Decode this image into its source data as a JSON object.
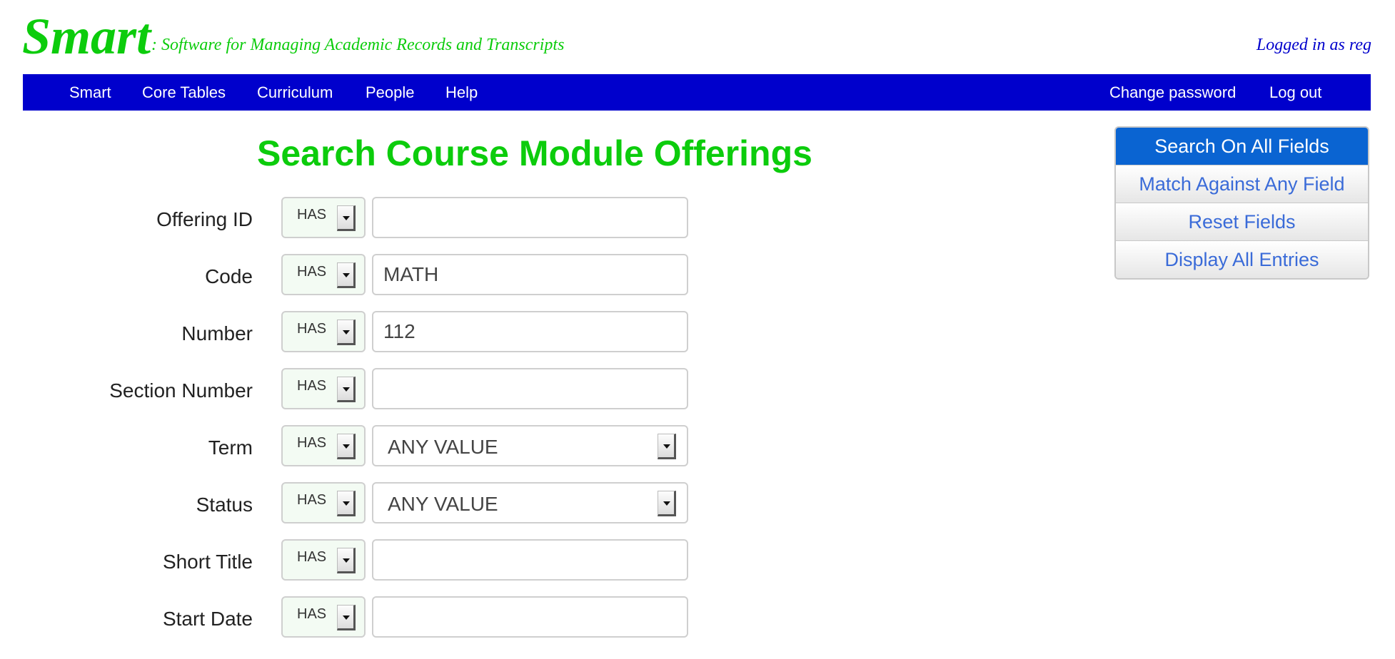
{
  "header": {
    "logo": "Smart",
    "tagline": ": Software for Managing Academic Records and Transcripts",
    "login_status": "Logged in as reg"
  },
  "nav": {
    "left_items": [
      "Smart",
      "Core Tables",
      "Curriculum",
      "People",
      "Help"
    ],
    "right_items": [
      "Change password",
      "Log out"
    ]
  },
  "page": {
    "title": "Search Course Module Offerings"
  },
  "form": {
    "fields": [
      {
        "label": "Offering ID",
        "operator": "HAS",
        "value": "",
        "control": "text"
      },
      {
        "label": "Code",
        "operator": "HAS",
        "value": "MATH",
        "control": "text"
      },
      {
        "label": "Number",
        "operator": "HAS",
        "value": "112",
        "control": "text"
      },
      {
        "label": "Section Number",
        "operator": "HAS",
        "value": "",
        "control": "text"
      },
      {
        "label": "Term",
        "operator": "HAS",
        "value": "ANY VALUE",
        "control": "select"
      },
      {
        "label": "Status",
        "operator": "HAS",
        "value": "ANY VALUE",
        "control": "select"
      },
      {
        "label": "Short Title",
        "operator": "HAS",
        "value": "",
        "control": "text"
      },
      {
        "label": "Start Date",
        "operator": "HAS",
        "value": "",
        "control": "text"
      }
    ]
  },
  "actions": {
    "search_all": "Search On All Fields",
    "match_any": "Match Against Any Field",
    "reset": "Reset Fields",
    "display_all": "Display All Entries"
  },
  "colors": {
    "brand_green": "#0ccc0c",
    "nav_blue": "#0000cc",
    "active_button": "#0a64d2",
    "link_blue": "#3a6bd8"
  }
}
